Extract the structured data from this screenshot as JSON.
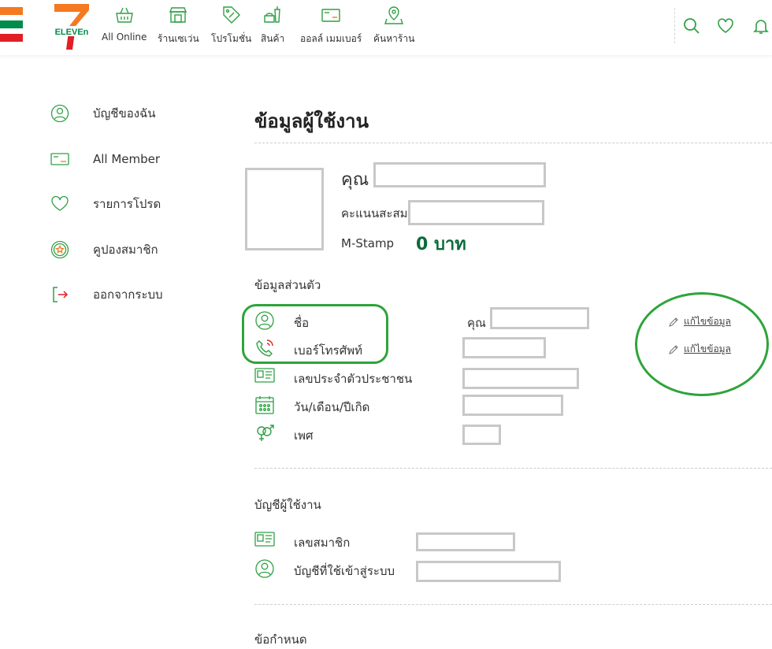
{
  "header": {
    "brand_colors": {
      "orange": "#f47920",
      "green": "#008c4a",
      "red": "#e01f26"
    },
    "logo_text": "ELEVEn",
    "nav": [
      {
        "label": "All Online",
        "icon": "basket-icon"
      },
      {
        "label": "ร้านเซเว่น",
        "icon": "store-icon"
      },
      {
        "label": "โปรโมชั่น",
        "icon": "promo-tag-icon"
      },
      {
        "label": "สินค้า",
        "icon": "product-icon"
      },
      {
        "label": "ออลล์ เมมเบอร์",
        "icon": "member-card-icon"
      },
      {
        "label": "ค้นหาร้าน",
        "icon": "map-pin-icon"
      }
    ]
  },
  "sidebar": {
    "items": [
      {
        "label": "บัญชีของฉัน",
        "icon": "user-icon"
      },
      {
        "label": "All Member",
        "icon": "member-card-icon"
      },
      {
        "label": "รายการโปรด",
        "icon": "heart-icon"
      },
      {
        "label": "คูปองสมาชิก",
        "icon": "coupon-star-icon"
      },
      {
        "label": "ออกจากระบบ",
        "icon": "logout-icon"
      }
    ]
  },
  "main": {
    "title": "ข้อมูลผู้ใช้งาน",
    "profile": {
      "name_prefix": "คุณ",
      "points_label": "คะแนนสะสม",
      "mstamp_label": "M-Stamp",
      "mstamp_value": "0 บาท"
    },
    "personal": {
      "title": "ข้อมูลส่วนตัว",
      "rows": [
        {
          "label": "ชื่อ",
          "icon": "user-icon",
          "value_prefix": "คุณ"
        },
        {
          "label": "เบอร์โทรศัพท์",
          "icon": "phone-icon"
        },
        {
          "label": "เลขประจำตัวประชาชน",
          "icon": "id-card-icon"
        },
        {
          "label": "วัน/เดือน/ปีเกิด",
          "icon": "calendar-icon"
        },
        {
          "label": "เพศ",
          "icon": "gender-icon"
        }
      ],
      "edit_label": "แก้ไขข้อมูล"
    },
    "account": {
      "title": "บัญชีผู้ใช้งาน",
      "rows": [
        {
          "label": "เลขสมาชิก",
          "icon": "id-card-icon"
        },
        {
          "label": "บัญชีที่ใช้เข้าสู่ระบบ",
          "icon": "user-icon"
        }
      ]
    },
    "terms_title": "ข้อกำหนด"
  }
}
